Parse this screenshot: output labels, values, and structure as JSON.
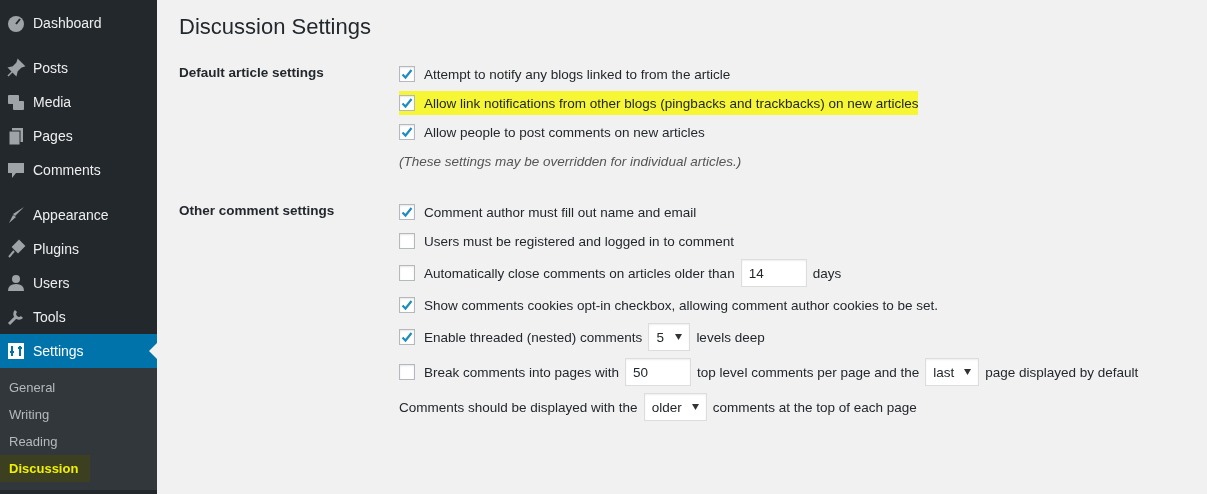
{
  "sidebar": {
    "groups": [
      [
        {
          "label": "Dashboard",
          "selected": false
        }
      ],
      [
        {
          "label": "Posts",
          "selected": false
        },
        {
          "label": "Media",
          "selected": false
        },
        {
          "label": "Pages",
          "selected": false
        },
        {
          "label": "Comments",
          "selected": false
        }
      ],
      [
        {
          "label": "Appearance",
          "selected": false
        },
        {
          "label": "Plugins",
          "selected": false
        },
        {
          "label": "Users",
          "selected": false
        },
        {
          "label": "Tools",
          "selected": false
        },
        {
          "label": "Settings",
          "selected": true
        }
      ]
    ],
    "submenu": [
      {
        "label": "General",
        "highlighted": false
      },
      {
        "label": "Writing",
        "highlighted": false
      },
      {
        "label": "Reading",
        "highlighted": false
      },
      {
        "label": "Discussion",
        "highlighted": true
      }
    ]
  },
  "page": {
    "title": "Discussion Settings",
    "sections": [
      {
        "label": "Default article settings",
        "rows": [
          {
            "kind": "checkbox",
            "checked": true,
            "highlighted": false,
            "parts": [
              {
                "kind": "text",
                "text": "Attempt to notify any blogs linked to from the article"
              }
            ]
          },
          {
            "kind": "checkbox",
            "checked": true,
            "highlighted": true,
            "parts": [
              {
                "kind": "text",
                "text": "Allow link notifications from other blogs (pingbacks and trackbacks) on new articles"
              }
            ]
          },
          {
            "kind": "checkbox",
            "checked": true,
            "highlighted": false,
            "parts": [
              {
                "kind": "text",
                "text": "Allow people to post comments on new articles"
              }
            ]
          },
          {
            "kind": "note",
            "parts": [
              {
                "kind": "text",
                "text": "(These settings may be overridden for individual articles.)"
              }
            ]
          }
        ]
      },
      {
        "label": "Other comment settings",
        "rows": [
          {
            "kind": "checkbox",
            "checked": true,
            "highlighted": false,
            "parts": [
              {
                "kind": "text",
                "text": "Comment author must fill out name and email"
              }
            ]
          },
          {
            "kind": "checkbox",
            "checked": false,
            "highlighted": false,
            "parts": [
              {
                "kind": "text",
                "text": "Users must be registered and logged in to comment"
              }
            ]
          },
          {
            "kind": "checkbox",
            "checked": false,
            "highlighted": false,
            "parts": [
              {
                "kind": "text",
                "text": "Automatically close comments on articles older than"
              },
              {
                "kind": "input",
                "value": "14"
              },
              {
                "kind": "text",
                "text": "days"
              }
            ]
          },
          {
            "kind": "checkbox",
            "checked": true,
            "highlighted": false,
            "parts": [
              {
                "kind": "text",
                "text": "Show comments cookies opt-in checkbox, allowing comment author cookies to be set."
              }
            ]
          },
          {
            "kind": "checkbox",
            "checked": true,
            "highlighted": false,
            "parts": [
              {
                "kind": "text",
                "text": "Enable threaded (nested) comments"
              },
              {
                "kind": "select",
                "value": "5"
              },
              {
                "kind": "text",
                "text": "levels deep"
              }
            ]
          },
          {
            "kind": "checkbox",
            "checked": false,
            "highlighted": false,
            "parts": [
              {
                "kind": "text",
                "text": "Break comments into pages with"
              },
              {
                "kind": "input",
                "value": "50"
              },
              {
                "kind": "text",
                "text": "top level comments per page and the"
              },
              {
                "kind": "select",
                "value": "last"
              },
              {
                "kind": "text",
                "text": "page displayed by default"
              }
            ]
          },
          {
            "kind": "plain",
            "parts": [
              {
                "kind": "text",
                "text": "Comments should be displayed with the"
              },
              {
                "kind": "select",
                "value": "older"
              },
              {
                "kind": "text",
                "text": "comments at the top of each page"
              }
            ]
          }
        ]
      }
    ]
  }
}
